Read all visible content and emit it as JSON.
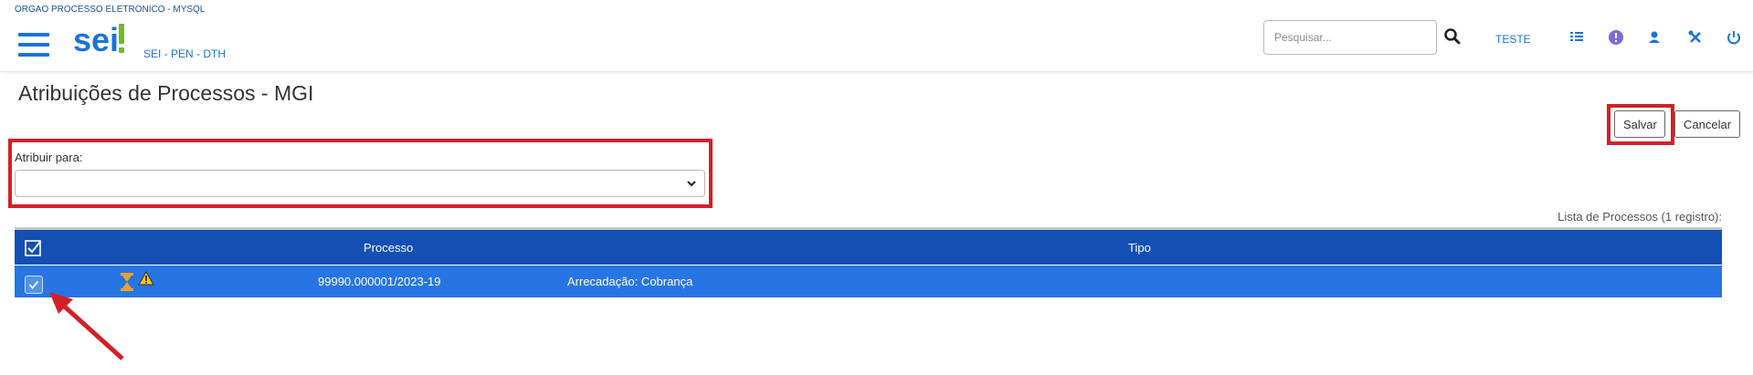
{
  "org_name": "ORGAO PROCESSO ELETRONICO - MYSQL",
  "logo_text": "sei!",
  "system_name": "SEI - PEN - DTH",
  "search": {
    "placeholder": "Pesquisar..."
  },
  "user_name": "TESTE",
  "page_title": "Atribuições de Processos - MGI",
  "buttons": {
    "save_label": "Salvar",
    "cancel_label": "Cancelar"
  },
  "assign": {
    "label": "Atribuir para:",
    "selected": ""
  },
  "list_caption": "Lista de Processos (1 registro):",
  "table": {
    "columns": [
      "Processo",
      "Tipo"
    ],
    "rows": [
      {
        "checked": true,
        "processo": "99990.000001/2023-19",
        "tipo": "Arrecadação: Cobrança",
        "icons": [
          "hourglass-icon",
          "warning-icon"
        ]
      }
    ]
  },
  "colors": {
    "brand_blue": "#1a73d9",
    "header_row": "#1450b3",
    "selected_row": "#2775e3",
    "highlight_red": "#d32027"
  }
}
